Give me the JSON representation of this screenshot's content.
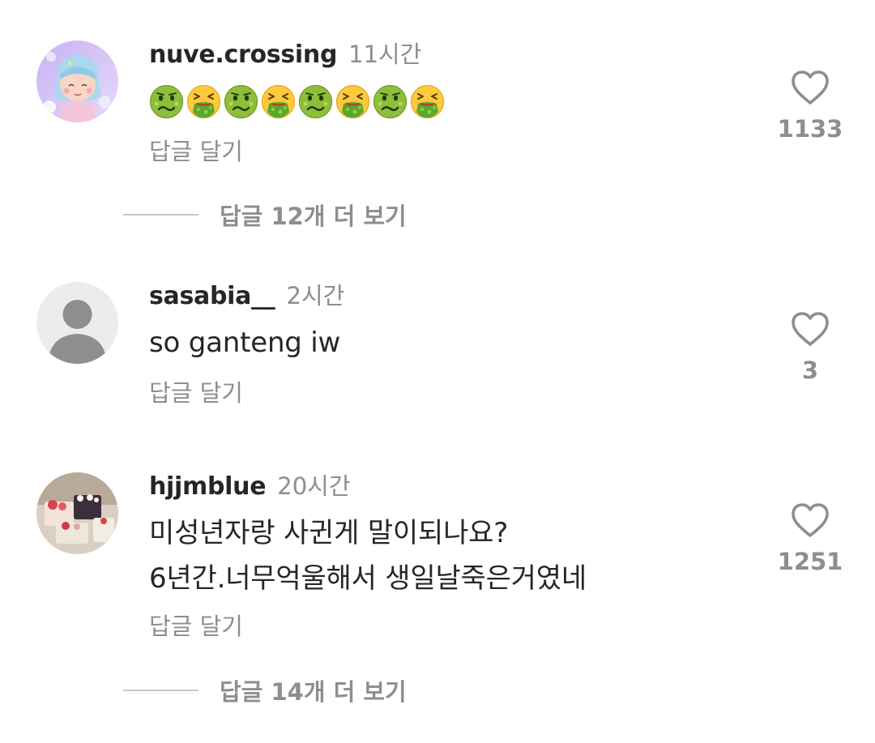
{
  "comments": [
    {
      "username": "nuve.crossing",
      "time": "11시간",
      "emojis": [
        "nauseated-face",
        "vomiting-face",
        "nauseated-face",
        "vomiting-face",
        "nauseated-face",
        "vomiting-face",
        "nauseated-face",
        "vomiting-face"
      ],
      "reply_label": "답글 달기",
      "likes": "1133",
      "view_more": "답글 12개 더 보기"
    },
    {
      "username": "sasabia__",
      "time": "2시간",
      "text": "so ganteng iw",
      "reply_label": "답글 달기",
      "likes": "3"
    },
    {
      "username": "hjjmblue",
      "time": "20시간",
      "text_lines": [
        "미성년자랑 사귄게 말이되나요?",
        "6년간.너무억울해서 생일날죽은거였네"
      ],
      "reply_label": "답글 달기",
      "likes": "1251",
      "view_more": "답글 14개 더 보기"
    }
  ],
  "icons": {
    "like": "heart-outline-icon",
    "default_avatar": "default-user-icon"
  },
  "colors": {
    "text": "#262626",
    "secondary": "#8e8e8e",
    "divider": "#c7c7c7",
    "background": "#ffffff"
  }
}
